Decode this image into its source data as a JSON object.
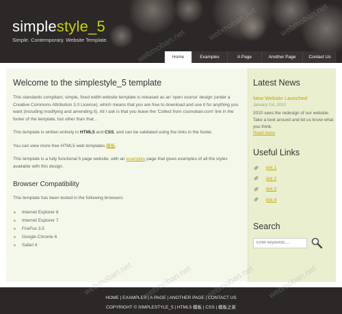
{
  "header": {
    "title_part1": "simple",
    "title_part2": "style_5",
    "slogan": "Simple. Contemporary. Website Template."
  },
  "menu": [
    {
      "label": "Home",
      "active": true
    },
    {
      "label": "Examples",
      "active": false
    },
    {
      "label": "A Page",
      "active": false
    },
    {
      "label": "Another Page",
      "active": false
    },
    {
      "label": "Contact Us",
      "active": false
    }
  ],
  "content": {
    "heading": "Welcome to the simplestyle_5 template",
    "p1": "This standards compliant, simple, fixed width website template is released as an 'open source' design (under a Creative Commons Attribution 3.0 Licence), which means that you are free to download and use it for anything you want (including modifying and amending it). All I ask is that you leave the 'Collect from cssmoban.com' link in the footer of the template, but other than that...",
    "p2_a": "This template is written entirely in ",
    "p2_b": "HTML5",
    "p2_c": " and ",
    "p2_d": "CSS",
    "p2_e": ", and can be validated using the links in the footer.",
    "p3_a": "You can view more free HTML5 web templates ",
    "p3_link": "模板",
    "p3_b": ".",
    "p4_a": "This template is a fully functional 5 page website, with an ",
    "p4_link": "examples",
    "p4_b": " page that gives examples of all the styles available with this design.",
    "section_heading": "Browser Compatibility",
    "p5": "This template has been tested in the following browsers:",
    "browsers": [
      "Internet Explorer 8",
      "Internet Explorer 7",
      "FireFox 3.5",
      "Google Chrome 6",
      "Safari 4"
    ]
  },
  "sidebar": {
    "news_heading": "Latest News",
    "news_title": "New Website Launched",
    "news_date": "January 1st, 2010",
    "news_text": "2010 sees the redesign of our website. Take a look around and let us know what you think.",
    "read_more": "Read more",
    "links_heading": "Useful Links",
    "links": [
      "link 1",
      "link 2",
      "link 3",
      "link 4"
    ],
    "search_heading": "Search",
    "search_placeholder": "Enter keywords....."
  },
  "footer": {
    "nav": [
      "HOME",
      "EXAMPLES",
      "A PAGE",
      "ANOTHER PAGE",
      "CONTACT US"
    ],
    "copyright": "COPYRIGHT © SIMPLESTYLE_5 | HTML5 模板 | CSS | 模板之家"
  },
  "watermark": "webmoban.net",
  "colors": {
    "header_bg": "#2b2827",
    "accent_title": "#c8d400",
    "link": "#c7a100",
    "content_bg": "#f4f8ea",
    "sidebar_bg": "#e9efcf"
  }
}
